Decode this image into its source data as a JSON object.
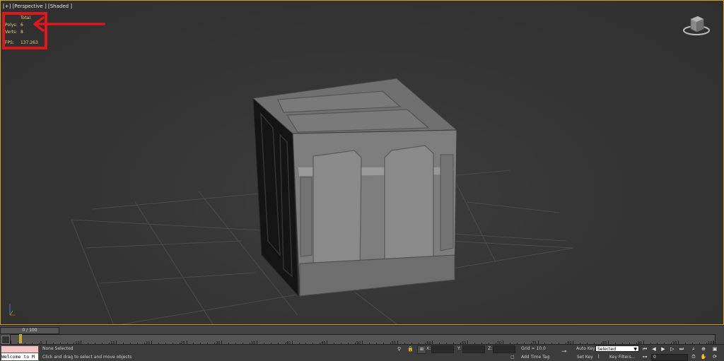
{
  "viewport": {
    "label": "[+] [Perspective ] [Shaded ]",
    "stats": {
      "total_label": "Total",
      "polys_label": "Polys:",
      "polys_value": "6",
      "verts_label": "Verts:",
      "verts_value": "8",
      "fps_label": "FPS:",
      "fps_value": "137.263"
    },
    "annotation_color": "#e0161b",
    "stats_color": "#e8d36a"
  },
  "timeline": {
    "slider_text": "0 / 100",
    "ticks": [
      "5",
      "10",
      "15",
      "20",
      "25",
      "30",
      "35",
      "40",
      "45",
      "50",
      "55",
      "60",
      "65",
      "70",
      "75",
      "80",
      "85",
      "90",
      "95",
      "100"
    ],
    "current_frame": 0,
    "total_frames": 100
  },
  "statusbar": {
    "maxscript_output": "Welcome to M",
    "selection_status": "None Selected",
    "prompt": "Click and drag to select and move objects",
    "x_label": "X:",
    "y_label": "Y:",
    "z_label": "Z:",
    "grid": "Grid = 10.0",
    "add_time_tag": "Add Time Tag",
    "auto_key": "Auto Key",
    "set_key": "Set Key",
    "selected_option": "Selected",
    "key_filters": "Key Filters...",
    "frame_value": "0"
  }
}
